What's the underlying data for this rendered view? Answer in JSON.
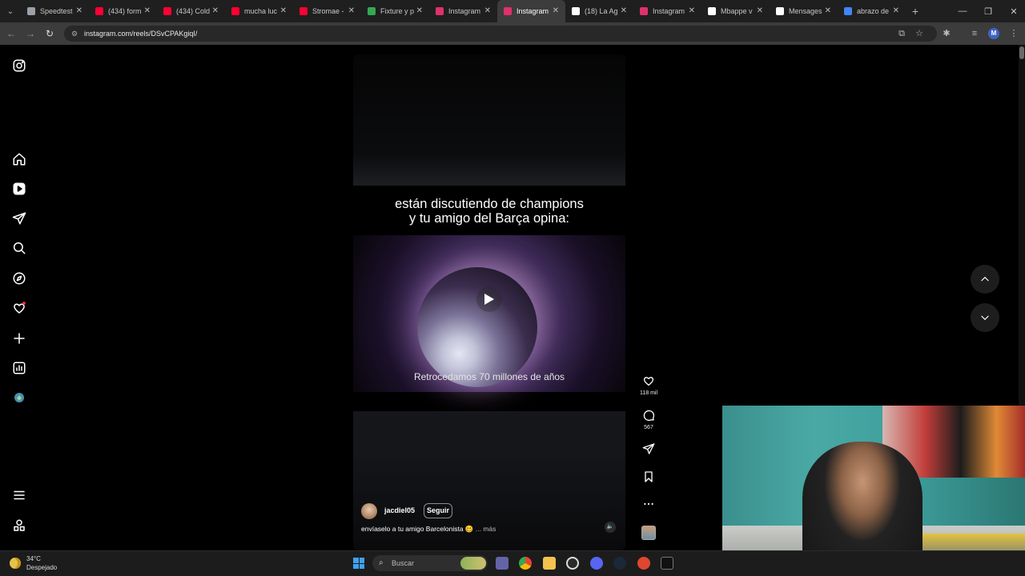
{
  "browser": {
    "tabs": [
      {
        "label": "Speedtest",
        "favicon": "speedtest-icon",
        "color": "#9aa0a6"
      },
      {
        "label": "(434) form",
        "favicon": "youtube-icon",
        "color": "#ff0033"
      },
      {
        "label": "(434) Cold",
        "favicon": "youtube-icon",
        "color": "#ff0033"
      },
      {
        "label": "mucha luc",
        "favicon": "youtube-icon",
        "color": "#ff0033"
      },
      {
        "label": "Stromae -",
        "favicon": "youtube-icon",
        "color": "#ff0033"
      },
      {
        "label": "Fixture y p",
        "favicon": "fixture-icon",
        "color": "#34a853"
      },
      {
        "label": "Instagram",
        "favicon": "instagram-icon",
        "color": "#e1306c"
      },
      {
        "label": "Instagram",
        "favicon": "instagram-icon",
        "color": "#e1306c",
        "active": true
      },
      {
        "label": "(18) La Ag",
        "favicon": "x-icon",
        "color": "#ffffff"
      },
      {
        "label": "Instagram",
        "favicon": "instagram-icon",
        "color": "#e1306c"
      },
      {
        "label": "Mbappe v",
        "favicon": "tiktok-icon",
        "color": "#ffffff"
      },
      {
        "label": "Mensages",
        "favicon": "tiktok-icon",
        "color": "#ffffff"
      },
      {
        "label": "abrazo de",
        "favicon": "google-icon",
        "color": "#4285f4"
      }
    ],
    "new_tab": "+",
    "url": "instagram.com/reels/DSvCPAKgiqI/",
    "profile_initial": "M"
  },
  "reel": {
    "caption_line1": "están discutiendo de champions",
    "caption_line2": "y tu amigo del Barça opina:",
    "subtitle": "Retrocedamos 70 millones de años",
    "author": "jacdiel05",
    "follow_label": "Seguir",
    "description": "envíaselo a tu amigo Barcelonista 🥴",
    "more_label": "... más",
    "likes": "118 mil",
    "comments": "567"
  },
  "taskbar": {
    "temperature": "34°C",
    "weather": "Despejado",
    "search_placeholder": "Buscar"
  },
  "colors": {
    "accent_notification": "#ff3040",
    "windows_blue": "#3ea1f0"
  }
}
